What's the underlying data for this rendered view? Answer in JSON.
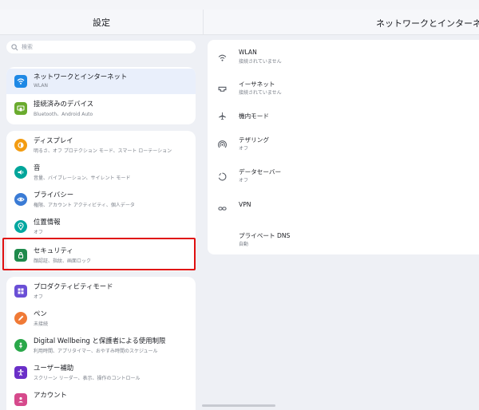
{
  "header": {
    "left_title": "設定",
    "right_title": "ネットワークとインターネット"
  },
  "search": {
    "placeholder": "検索"
  },
  "sidebar": {
    "group1": [
      {
        "title": "ネットワークとインターネット",
        "subtitle": "WLAN",
        "icon": "wifi-icon",
        "color": "#1e88e5"
      },
      {
        "title": "接続済みのデバイス",
        "subtitle": "Bluetooth、Android Auto",
        "icon": "devices-icon",
        "color": "#6aab2e"
      }
    ],
    "group2": [
      {
        "title": "ディスプレイ",
        "subtitle": "明るさ、オフ プロテクション モード、スマート ローテーション",
        "icon": "display-icon",
        "color": "#f39c12"
      },
      {
        "title": "音",
        "subtitle": "音量、バイブレーション、サイレント モード",
        "icon": "sound-icon",
        "color": "#00a59a"
      },
      {
        "title": "プライバシー",
        "subtitle": "権限、アカウント アクティビティ、個人データ",
        "icon": "privacy-icon",
        "color": "#3a7bd5"
      },
      {
        "title": "位置情報",
        "subtitle": "オフ",
        "icon": "location-icon",
        "color": "#00a7a0"
      },
      {
        "title": "セキュリティ",
        "subtitle": "顔認証、指紋、画面ロック",
        "icon": "lock-icon",
        "color": "#1f8a4c"
      }
    ],
    "group3": [
      {
        "title": "プロダクティビティモード",
        "subtitle": "オフ",
        "icon": "productivity-icon",
        "color": "#6a4fd6"
      },
      {
        "title": "ペン",
        "subtitle": "未接続",
        "icon": "pen-icon",
        "color": "#f07a36"
      },
      {
        "title": "Digital Wellbeing と保護者による使用制限",
        "subtitle": "利用時間、アプリタイマー、おやすみ時間のスケジュール",
        "icon": "wellbeing-icon",
        "color": "#2aa84a"
      },
      {
        "title": "ユーザー補助",
        "subtitle": "スクリーン リーダー、表示、操作のコントロール",
        "icon": "accessibility-icon",
        "color": "#6a2fc8"
      },
      {
        "title": "アカウント",
        "subtitle": "",
        "icon": "account-icon",
        "color": "#d64a8c"
      }
    ]
  },
  "network": [
    {
      "title": "WLAN",
      "subtitle": "接続されていません",
      "icon": "wifi-icon"
    },
    {
      "title": "イーサネット",
      "subtitle": "接続されていません",
      "icon": "ethernet-icon"
    },
    {
      "title": "機内モード",
      "subtitle": "",
      "icon": "airplane-icon"
    },
    {
      "title": "テザリング",
      "subtitle": "オフ",
      "icon": "hotspot-icon"
    },
    {
      "title": "データセーバー",
      "subtitle": "オフ",
      "icon": "data-saver-icon"
    },
    {
      "title": "VPN",
      "subtitle": "",
      "icon": "vpn-icon"
    },
    {
      "title": "プライベート DNS",
      "subtitle": "自動",
      "icon": ""
    }
  ]
}
